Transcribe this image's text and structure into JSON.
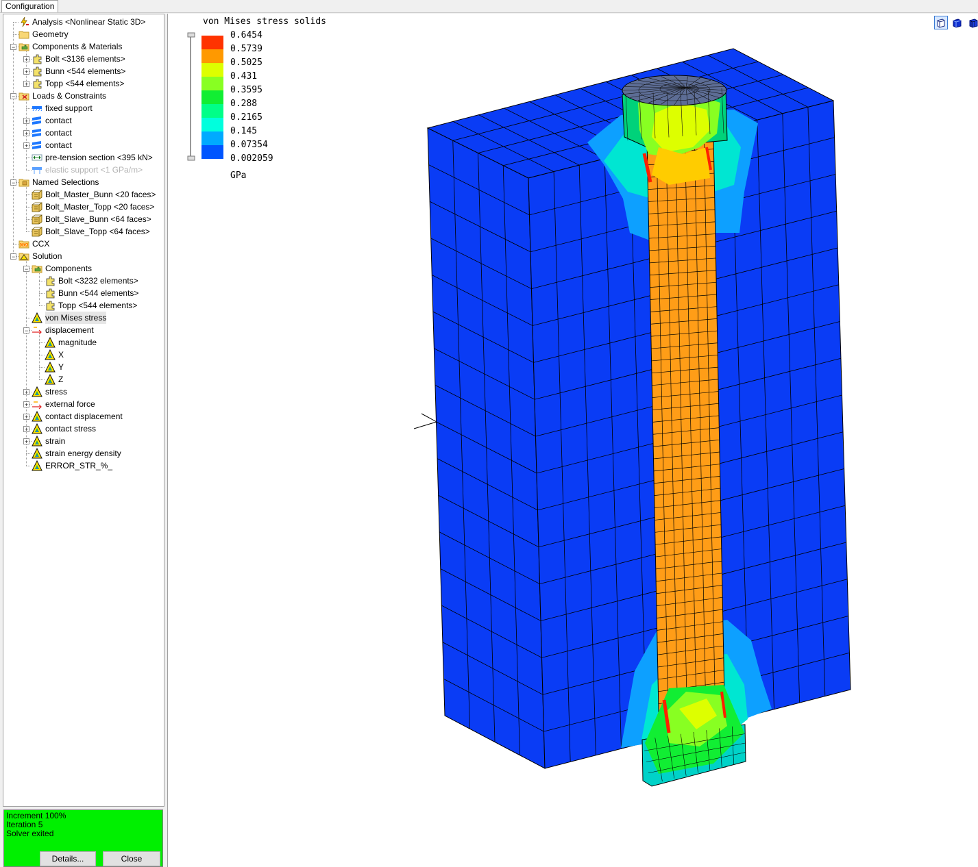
{
  "tab": {
    "label": "Configuration"
  },
  "tree": [
    {
      "label": "Analysis <Nonlinear Static 3D>",
      "icon": "analysis-icon"
    },
    {
      "label": "Geometry",
      "icon": "folder-icon"
    },
    {
      "label": "Components & Materials",
      "icon": "components-folder-icon"
    },
    {
      "label": "Bolt <3136 elements>",
      "icon": "component-icon"
    },
    {
      "label": "Bunn <544 elements>",
      "icon": "component-icon"
    },
    {
      "label": "Topp <544 elements>",
      "icon": "component-icon"
    },
    {
      "label": "Loads & Constraints",
      "icon": "loads-folder-icon"
    },
    {
      "label": "fixed support",
      "icon": "fixed-support-icon"
    },
    {
      "label": "contact",
      "icon": "contact-icon"
    },
    {
      "label": "contact",
      "icon": "contact-icon"
    },
    {
      "label": "contact",
      "icon": "contact-icon"
    },
    {
      "label": "pre-tension section <395 kN>",
      "icon": "pretension-icon"
    },
    {
      "label": "elastic support <1 GPa/m>",
      "icon": "elastic-support-icon"
    },
    {
      "label": "Named Selections",
      "icon": "named-selections-folder-icon"
    },
    {
      "label": "Bolt_Master_Bunn <20 faces>",
      "icon": "face-selection-icon"
    },
    {
      "label": "Bolt_Master_Topp <20 faces>",
      "icon": "face-selection-icon"
    },
    {
      "label": "Bolt_Slave_Bunn <64 faces>",
      "icon": "face-selection-icon"
    },
    {
      "label": "Bolt_Slave_Topp <64 faces>",
      "icon": "face-selection-icon"
    },
    {
      "label": "CCX",
      "icon": "ccx-icon"
    },
    {
      "label": "Solution",
      "icon": "solution-icon"
    },
    {
      "label": "Components",
      "icon": "components-folder-icon"
    },
    {
      "label": "Bolt <3232 elements>",
      "icon": "component-icon"
    },
    {
      "label": "Bunn <544 elements>",
      "icon": "component-icon"
    },
    {
      "label": "Topp <544 elements>",
      "icon": "component-icon"
    },
    {
      "label": "von Mises stress",
      "icon": "result-icon"
    },
    {
      "label": "displacement",
      "icon": "displacement-icon"
    },
    {
      "label": "magnitude",
      "icon": "result-icon"
    },
    {
      "label": "X",
      "icon": "result-icon"
    },
    {
      "label": "Y",
      "icon": "result-icon"
    },
    {
      "label": "Z",
      "icon": "result-icon"
    },
    {
      "label": "stress",
      "icon": "result-icon"
    },
    {
      "label": "external force",
      "icon": "force-icon"
    },
    {
      "label": "contact displacement",
      "icon": "result-icon"
    },
    {
      "label": "contact stress",
      "icon": "result-icon"
    },
    {
      "label": "strain",
      "icon": "result-icon"
    },
    {
      "label": "strain energy density",
      "icon": "result-icon"
    },
    {
      "label": "ERROR_STR_%_",
      "icon": "result-icon"
    }
  ],
  "status": {
    "increment": "Increment 100%",
    "iteration": "Iteration 5",
    "solver": "Solver exited",
    "details_label": "Details...",
    "close_label": "Close"
  },
  "legend": {
    "title": "von Mises stress solids",
    "unit": "GPa",
    "values": [
      "0.6454",
      "0.5739",
      "0.5025",
      "0.431",
      "0.3595",
      "0.288",
      "0.2165",
      "0.145",
      "0.07354",
      "0.002059"
    ],
    "colors": [
      "#ff3300",
      "#ff9900",
      "#ddff00",
      "#88ff22",
      "#11ee33",
      "#00ff88",
      "#00ffdd",
      "#00aaff",
      "#0055ff"
    ]
  },
  "view_buttons": [
    {
      "icon": "view-iso-icon"
    },
    {
      "icon": "view-solid-icon"
    },
    {
      "icon": "view-wireframe-icon"
    }
  ],
  "colors": {
    "block": "#0a3cf5",
    "bolt": "#ff9d17",
    "status": "#00f000"
  }
}
